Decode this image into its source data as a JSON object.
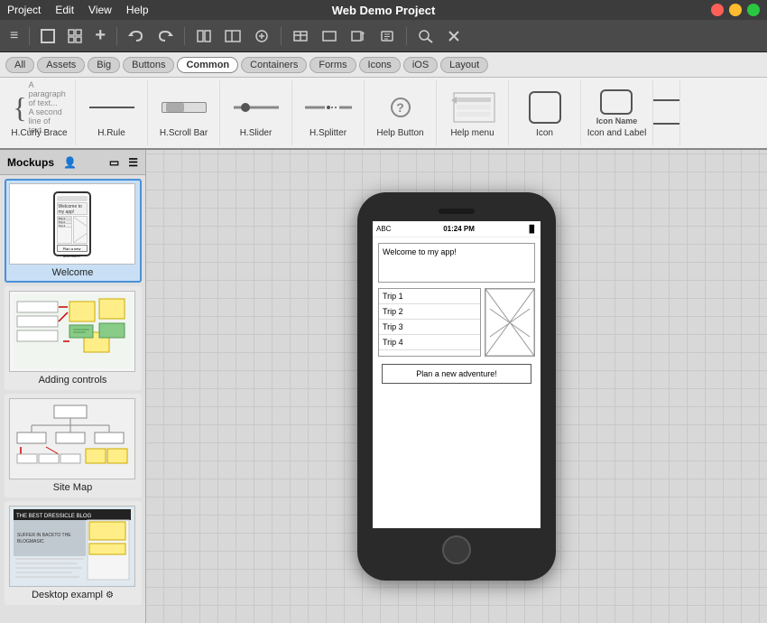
{
  "app": {
    "title": "Web Demo Project"
  },
  "menu": {
    "items": [
      "Project",
      "Edit",
      "View",
      "Help"
    ]
  },
  "toolbar": {
    "undo": "↩",
    "redo": "↪",
    "icons": [
      "⊞",
      "⊟",
      "⊠",
      "⊡",
      "⊞",
      "⊟"
    ],
    "plus": "+",
    "hamburger": "≡",
    "layout1": "▣",
    "layout2": "⊞"
  },
  "filter_bar": {
    "buttons": [
      "All",
      "Assets",
      "Big",
      "Buttons",
      "Common",
      "Containers",
      "Forms",
      "Icons",
      "iOS",
      "Layout"
    ]
  },
  "components": [
    {
      "label": "H.Curly Brace",
      "type": "curly"
    },
    {
      "label": "H.Rule",
      "type": "rule"
    },
    {
      "label": "H.Scroll Bar",
      "type": "scrollbar"
    },
    {
      "label": "H.Slider",
      "type": "slider"
    },
    {
      "label": "H.Splitter",
      "type": "splitter"
    },
    {
      "label": "Help Button",
      "type": "helpbtn"
    },
    {
      "label": "Help menu",
      "type": "helpmenu"
    },
    {
      "label": "Icon",
      "type": "icon"
    },
    {
      "label": "Icon and Label",
      "type": "iconlabel"
    }
  ],
  "sidebar": {
    "title": "Mockups",
    "items": [
      {
        "id": "welcome",
        "label": "Welcome",
        "active": true
      },
      {
        "id": "adding-controls",
        "label": "Adding controls",
        "active": false
      },
      {
        "id": "site-map",
        "label": "Site Map",
        "active": false
      },
      {
        "id": "desktop-example",
        "label": "Desktop exampl",
        "active": false
      }
    ]
  },
  "phone_screen": {
    "carrier": "ABC",
    "time": "01:24 PM",
    "battery": "▐▌",
    "welcome_text": "Welcome to my app!",
    "list_items": [
      "Trip 1",
      "Trip 2",
      "Trip 3",
      "Trip 4"
    ],
    "button_label": "Plan a new adventure!"
  }
}
